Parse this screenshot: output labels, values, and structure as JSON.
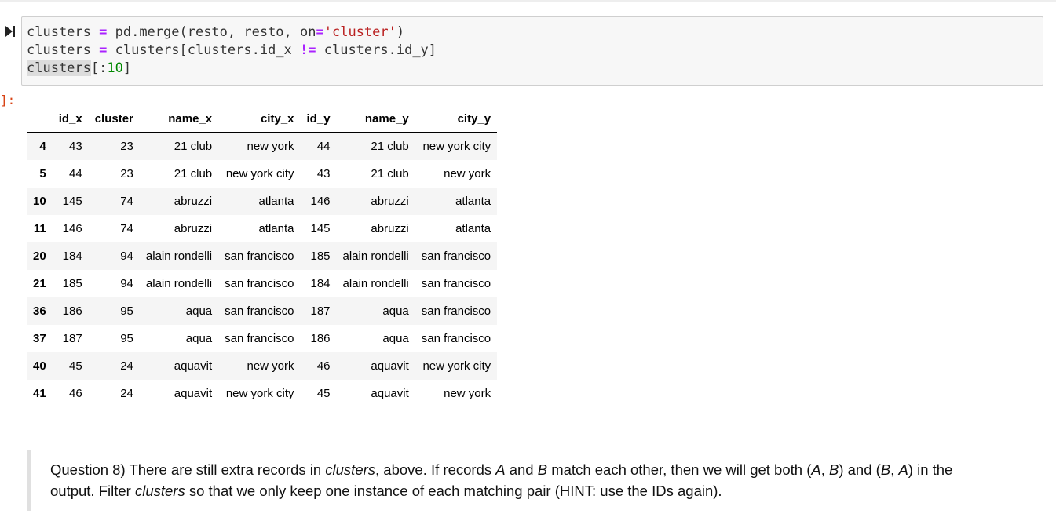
{
  "code_cell": {
    "lines": [
      [
        {
          "t": "clusters ",
          "k": ""
        },
        {
          "t": "=",
          "k": "op"
        },
        {
          "t": " pd.merge(resto, resto, on",
          "k": ""
        },
        {
          "t": "=",
          "k": "op"
        },
        {
          "t": "'cluster'",
          "k": "str"
        },
        {
          "t": ")",
          "k": ""
        }
      ],
      [
        {
          "t": "clusters ",
          "k": ""
        },
        {
          "t": "=",
          "k": "op"
        },
        {
          "t": " clusters[clusters.id_x ",
          "k": ""
        },
        {
          "t": "!=",
          "k": "op"
        },
        {
          "t": " clusters.id_y]",
          "k": ""
        }
      ],
      [
        {
          "t": "clusters",
          "k": "hl"
        },
        {
          "t": "[:",
          "k": ""
        },
        {
          "t": "10",
          "k": "num"
        },
        {
          "t": "]",
          "k": ""
        }
      ]
    ]
  },
  "output": {
    "prompt": "]:",
    "table": {
      "columns": [
        "",
        "id_x",
        "cluster",
        "name_x",
        "city_x",
        "id_y",
        "name_y",
        "city_y"
      ],
      "rows": [
        [
          "4",
          "43",
          "23",
          "21 club",
          "new york",
          "44",
          "21 club",
          "new york city"
        ],
        [
          "5",
          "44",
          "23",
          "21 club",
          "new york city",
          "43",
          "21 club",
          "new york"
        ],
        [
          "10",
          "145",
          "74",
          "abruzzi",
          "atlanta",
          "146",
          "abruzzi",
          "atlanta"
        ],
        [
          "11",
          "146",
          "74",
          "abruzzi",
          "atlanta",
          "145",
          "abruzzi",
          "atlanta"
        ],
        [
          "20",
          "184",
          "94",
          "alain rondelli",
          "san francisco",
          "185",
          "alain rondelli",
          "san francisco"
        ],
        [
          "21",
          "185",
          "94",
          "alain rondelli",
          "san francisco",
          "184",
          "alain rondelli",
          "san francisco"
        ],
        [
          "36",
          "186",
          "95",
          "aqua",
          "san francisco",
          "187",
          "aqua",
          "san francisco"
        ],
        [
          "37",
          "187",
          "95",
          "aqua",
          "san francisco",
          "186",
          "aqua",
          "san francisco"
        ],
        [
          "40",
          "45",
          "24",
          "aquavit",
          "new york",
          "46",
          "aquavit",
          "new york city"
        ],
        [
          "41",
          "46",
          "24",
          "aquavit",
          "new york city",
          "45",
          "aquavit",
          "new york"
        ]
      ]
    }
  },
  "markdown": {
    "segments": [
      {
        "t": "Question 8) There are still extra records in ",
        "i": false
      },
      {
        "t": "clusters",
        "i": true
      },
      {
        "t": ", above. If records ",
        "i": false
      },
      {
        "t": "A",
        "i": true
      },
      {
        "t": " and ",
        "i": false
      },
      {
        "t": "B",
        "i": true
      },
      {
        "t": " match each other, then we will get both (",
        "i": false
      },
      {
        "t": "A",
        "i": true
      },
      {
        "t": ", ",
        "i": false
      },
      {
        "t": "B",
        "i": true
      },
      {
        "t": ") and (",
        "i": false
      },
      {
        "t": "B",
        "i": true
      },
      {
        "t": ", ",
        "i": false
      },
      {
        "t": "A",
        "i": true
      },
      {
        "t": ") in the output. Filter ",
        "i": false
      },
      {
        "t": "clusters",
        "i": true
      },
      {
        "t": " so that we only keep one instance of each matching pair (HINT: use the IDs again).",
        "i": false
      }
    ]
  },
  "icons": {
    "run": "run-cell-icon"
  },
  "colors": {
    "operator": "#aa22ff",
    "string": "#ba2121",
    "number": "#008800",
    "prompt": "#d84315"
  }
}
